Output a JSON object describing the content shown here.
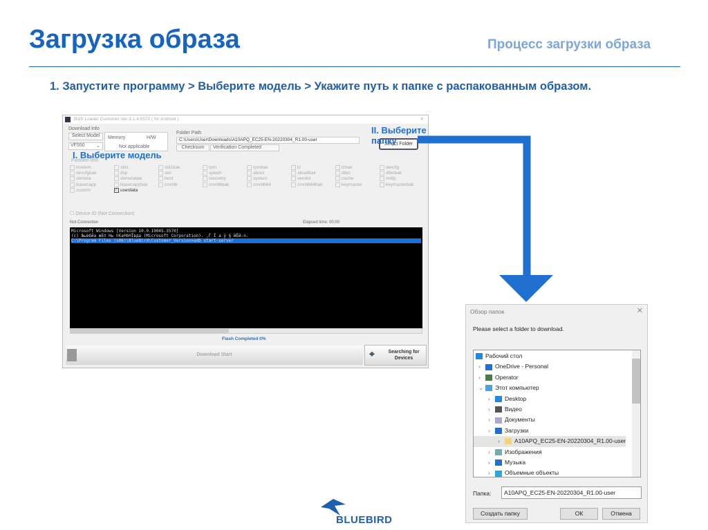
{
  "slide": {
    "title": "Загрузка образа",
    "subtitle": "Процесс загрузки образа",
    "step": "1. Запустите программу > Выберите модель > Укажите путь к папке с распакованным образом.",
    "annotation_model": "I. Выберите модель",
    "annotation_folder": "II. Выберите папку",
    "logo": "BLUEBIRD",
    "accent": "#1565c0"
  },
  "app": {
    "window_title": "BOS Loader Customer Ver-1.1.4.5572 ( for Android )",
    "download_info": "Download Info",
    "select_model": "Select Model",
    "model": "VF550",
    "memory": "Memory",
    "hw": "H/W",
    "not_applicable": "Not applicable",
    "folder_path_label": "Folder Path",
    "folder_path": "C:\\Users\\User\\Downloads\\A10APQ_EC25-EN-20220304_R1.00-user",
    "select_folder": "Select Folder",
    "checksum": "Checksum",
    "verification": "Verification Completed",
    "partition_info": "Partition Info",
    "partitions": [
      "modem",
      "sbl1",
      "sbl1bak",
      "rpm",
      "rpmbak",
      "tz",
      "tzbak",
      "devcfg",
      "devcfgbak",
      "dsp",
      "sec",
      "splash",
      "aboot",
      "abootbak",
      "dtbo",
      "dtbobak",
      "vbmeta",
      "vbmetabak",
      "boot",
      "recovery",
      "system",
      "vendor",
      "cache",
      "mdtp",
      "lkasecapp",
      "lkasecappbak",
      "cmnlib",
      "cmnlibbak",
      "cmnlib64",
      "cmnlib64bak",
      "keymaster",
      "keymasterbak",
      "custom",
      "userdata"
    ],
    "device_id": "Device ID (Not Connection)",
    "status": "Not Connection",
    "elapsed": "Elapsed time: 00:00",
    "console": [
      "Microsoft Windows [Version 10.0.19045.3570]",
      "(c) Љьвбйа жЕп Нь ©Єа®б®Ївда (Microsoft Corporation). ‚Ѓ Ї а ў  § йЁй-n.",
      "C:\\Program Files (x86)\\BlueBird\\Customer_Version>adb start-server"
    ],
    "flash": "Flash  Completed 0%",
    "download_start": "Download Start",
    "searching": "Searching for Devices"
  },
  "dialog": {
    "title": "Обзор папок",
    "prompt": "Please select a folder to download.",
    "tree": [
      {
        "label": "Рабочий стол",
        "icon": "desktop-icon",
        "color": "#1e88e5"
      },
      {
        "label": "OneDrive - Personal",
        "icon": "cloud-icon",
        "color": "#1e6fd0"
      },
      {
        "label": "Operator",
        "icon": "user-icon",
        "color": "#4a7a4a"
      },
      {
        "label": "Этот компьютер",
        "icon": "computer-icon",
        "color": "#4aa3e0"
      },
      {
        "label": "Desktop",
        "icon": "desktop-icon",
        "color": "#1e88e5"
      },
      {
        "label": "Видео",
        "icon": "video-icon",
        "color": "#555"
      },
      {
        "label": "Документы",
        "icon": "document-icon",
        "color": "#aac"
      },
      {
        "label": "Загрузки",
        "icon": "download-icon",
        "color": "#1e6fd0"
      },
      {
        "label": "A10APQ_EC25-EN-20220304_R1.00-user",
        "icon": "folder-icon",
        "color": "#f3d37a"
      },
      {
        "label": "Изображения",
        "icon": "image-icon",
        "color": "#7aa"
      },
      {
        "label": "Музыка",
        "icon": "music-icon",
        "color": "#1e6fd0"
      },
      {
        "label": "Объемные объекты",
        "icon": "3d-icon",
        "color": "#2aa8d8"
      }
    ],
    "folder_label": "Папка:",
    "folder_value": "A10APQ_EC25-EN-20220304_R1.00-user",
    "new_folder": "Создать папку",
    "ok": "ОК",
    "cancel": "Отмена"
  }
}
